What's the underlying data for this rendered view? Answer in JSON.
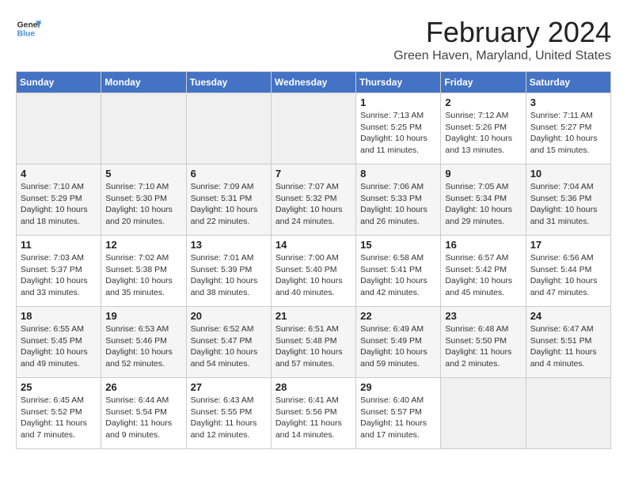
{
  "header": {
    "logo_line1": "General",
    "logo_line2": "Blue",
    "title": "February 2024",
    "subtitle": "Green Haven, Maryland, United States"
  },
  "days_of_week": [
    "Sunday",
    "Monday",
    "Tuesday",
    "Wednesday",
    "Thursday",
    "Friday",
    "Saturday"
  ],
  "weeks": [
    [
      {
        "day": "",
        "info": ""
      },
      {
        "day": "",
        "info": ""
      },
      {
        "day": "",
        "info": ""
      },
      {
        "day": "",
        "info": ""
      },
      {
        "day": "1",
        "info": "Sunrise: 7:13 AM\nSunset: 5:25 PM\nDaylight: 10 hours\nand 11 minutes."
      },
      {
        "day": "2",
        "info": "Sunrise: 7:12 AM\nSunset: 5:26 PM\nDaylight: 10 hours\nand 13 minutes."
      },
      {
        "day": "3",
        "info": "Sunrise: 7:11 AM\nSunset: 5:27 PM\nDaylight: 10 hours\nand 15 minutes."
      }
    ],
    [
      {
        "day": "4",
        "info": "Sunrise: 7:10 AM\nSunset: 5:29 PM\nDaylight: 10 hours\nand 18 minutes."
      },
      {
        "day": "5",
        "info": "Sunrise: 7:10 AM\nSunset: 5:30 PM\nDaylight: 10 hours\nand 20 minutes."
      },
      {
        "day": "6",
        "info": "Sunrise: 7:09 AM\nSunset: 5:31 PM\nDaylight: 10 hours\nand 22 minutes."
      },
      {
        "day": "7",
        "info": "Sunrise: 7:07 AM\nSunset: 5:32 PM\nDaylight: 10 hours\nand 24 minutes."
      },
      {
        "day": "8",
        "info": "Sunrise: 7:06 AM\nSunset: 5:33 PM\nDaylight: 10 hours\nand 26 minutes."
      },
      {
        "day": "9",
        "info": "Sunrise: 7:05 AM\nSunset: 5:34 PM\nDaylight: 10 hours\nand 29 minutes."
      },
      {
        "day": "10",
        "info": "Sunrise: 7:04 AM\nSunset: 5:36 PM\nDaylight: 10 hours\nand 31 minutes."
      }
    ],
    [
      {
        "day": "11",
        "info": "Sunrise: 7:03 AM\nSunset: 5:37 PM\nDaylight: 10 hours\nand 33 minutes."
      },
      {
        "day": "12",
        "info": "Sunrise: 7:02 AM\nSunset: 5:38 PM\nDaylight: 10 hours\nand 35 minutes."
      },
      {
        "day": "13",
        "info": "Sunrise: 7:01 AM\nSunset: 5:39 PM\nDaylight: 10 hours\nand 38 minutes."
      },
      {
        "day": "14",
        "info": "Sunrise: 7:00 AM\nSunset: 5:40 PM\nDaylight: 10 hours\nand 40 minutes."
      },
      {
        "day": "15",
        "info": "Sunrise: 6:58 AM\nSunset: 5:41 PM\nDaylight: 10 hours\nand 42 minutes."
      },
      {
        "day": "16",
        "info": "Sunrise: 6:57 AM\nSunset: 5:42 PM\nDaylight: 10 hours\nand 45 minutes."
      },
      {
        "day": "17",
        "info": "Sunrise: 6:56 AM\nSunset: 5:44 PM\nDaylight: 10 hours\nand 47 minutes."
      }
    ],
    [
      {
        "day": "18",
        "info": "Sunrise: 6:55 AM\nSunset: 5:45 PM\nDaylight: 10 hours\nand 49 minutes."
      },
      {
        "day": "19",
        "info": "Sunrise: 6:53 AM\nSunset: 5:46 PM\nDaylight: 10 hours\nand 52 minutes."
      },
      {
        "day": "20",
        "info": "Sunrise: 6:52 AM\nSunset: 5:47 PM\nDaylight: 10 hours\nand 54 minutes."
      },
      {
        "day": "21",
        "info": "Sunrise: 6:51 AM\nSunset: 5:48 PM\nDaylight: 10 hours\nand 57 minutes."
      },
      {
        "day": "22",
        "info": "Sunrise: 6:49 AM\nSunset: 5:49 PM\nDaylight: 10 hours\nand 59 minutes."
      },
      {
        "day": "23",
        "info": "Sunrise: 6:48 AM\nSunset: 5:50 PM\nDaylight: 11 hours\nand 2 minutes."
      },
      {
        "day": "24",
        "info": "Sunrise: 6:47 AM\nSunset: 5:51 PM\nDaylight: 11 hours\nand 4 minutes."
      }
    ],
    [
      {
        "day": "25",
        "info": "Sunrise: 6:45 AM\nSunset: 5:52 PM\nDaylight: 11 hours\nand 7 minutes."
      },
      {
        "day": "26",
        "info": "Sunrise: 6:44 AM\nSunset: 5:54 PM\nDaylight: 11 hours\nand 9 minutes."
      },
      {
        "day": "27",
        "info": "Sunrise: 6:43 AM\nSunset: 5:55 PM\nDaylight: 11 hours\nand 12 minutes."
      },
      {
        "day": "28",
        "info": "Sunrise: 6:41 AM\nSunset: 5:56 PM\nDaylight: 11 hours\nand 14 minutes."
      },
      {
        "day": "29",
        "info": "Sunrise: 6:40 AM\nSunset: 5:57 PM\nDaylight: 11 hours\nand 17 minutes."
      },
      {
        "day": "",
        "info": ""
      },
      {
        "day": "",
        "info": ""
      }
    ]
  ]
}
